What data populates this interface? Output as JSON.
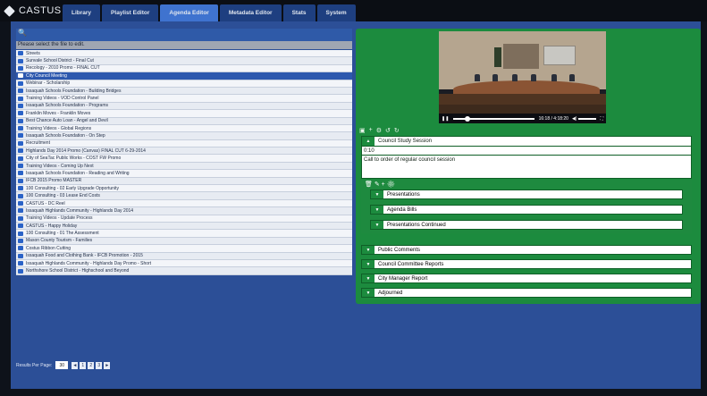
{
  "brand": {
    "name": "CASTUS"
  },
  "nav": {
    "tabs": [
      {
        "label": "Library"
      },
      {
        "label": "Playlist Editor"
      },
      {
        "label": "Agenda Editor"
      },
      {
        "label": "Metadata Editor"
      },
      {
        "label": "Stats"
      },
      {
        "label": "System"
      }
    ]
  },
  "left": {
    "search_glyph": "🔍",
    "header": "Please select the file to edit.",
    "files": [
      "Streets",
      "Sunvale School District - Final Cut",
      "Recology - 2010 Promo - FINAL CUT",
      "City Council Meeting",
      "Webinar - Scholarship",
      "Issaquah Schools Foundation - Building Bridges",
      "Training Videos - VOD Control Panel",
      "Issaquah Schools Foundation - Programs",
      "Franklin Moves - Franklin Moves",
      "Best Chance Auto Loan - Angel and Devil",
      "Training Videos - Global Regions",
      "Issaquah Schools Foundation - On Step",
      "Recruitment",
      "Highlands Day 2014 Promo (Canvas) FINAL CUT 6-29-2014",
      "City of SeaTac Public Works - COST FW Promo",
      "Training Videos - Coming Up Next",
      "Issaquah Schools Foundation - Reading and Writing",
      "IFCB 2015 Promo MASTER",
      "100 Consulting - 02 Early Upgrade Opportunity",
      "100 Consulting - 03 Lease End Costs",
      "CASTUS - DC Reel",
      "Issaquah Highlands Community - Highlands Day 2014",
      "Training Videos - Update Process",
      "CASTUS - Happy Holiday",
      "100 Consulting - 01 The Assessment",
      "Mason County Tourism - Families",
      "Costus Ribbon Cutting",
      "Issaquah Food and Clothing Bank - IFCB Promotion - 2015",
      "Issaquah Highlands Community - Highlands Day Promo - Short",
      "Northshore School District - Highschool and Beyond"
    ],
    "selected_index": 3,
    "pager": {
      "label": "Results Per Page:",
      "per_page": "30",
      "pages": [
        "◄",
        "1",
        "2",
        "3",
        "►"
      ]
    }
  },
  "agenda": {
    "video": {
      "time": "16:18 / 4:18:20"
    },
    "item_title": "Council Study Session",
    "item_time": "0:10",
    "item_notes": "Call to order of regular council session",
    "sub_items": [
      "Presentations",
      "Agenda Bills",
      "Presentations Continued"
    ],
    "items": [
      "Public Comments",
      "Council Committee Reports",
      "City Manager Report",
      "Adjourned"
    ]
  }
}
